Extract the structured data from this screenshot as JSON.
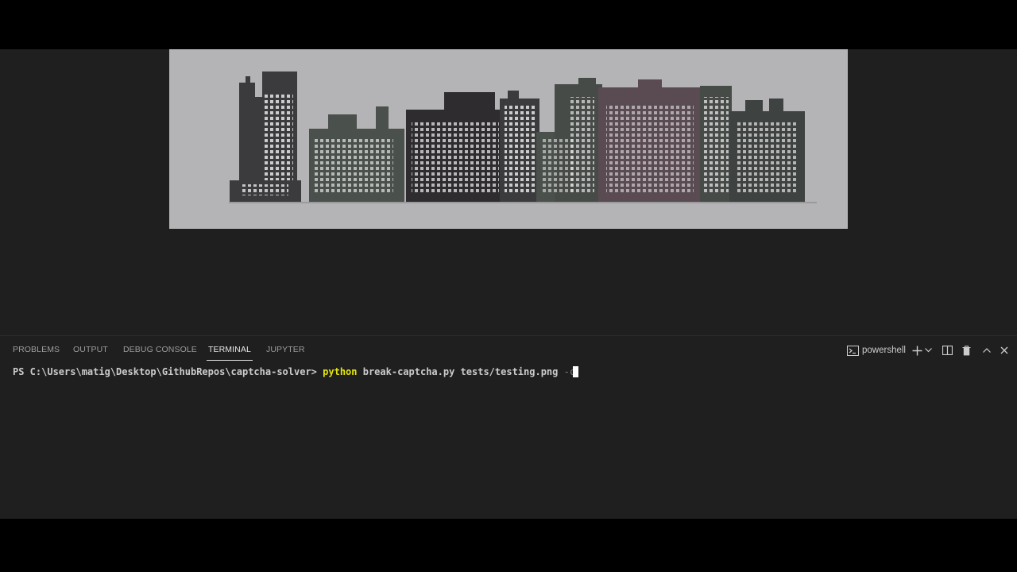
{
  "panel": {
    "tabs": [
      {
        "label": "PROBLEMS"
      },
      {
        "label": "OUTPUT"
      },
      {
        "label": "DEBUG CONSOLE"
      },
      {
        "label": "TERMINAL"
      },
      {
        "label": "JUPYTER"
      }
    ],
    "active_tab": "TERMINAL",
    "shell_name": "powershell",
    "icons": [
      "terminal-icon",
      "plus-icon",
      "chevron-down-icon",
      "split-icon",
      "trash-icon",
      "chevron-up-icon",
      "close-icon"
    ]
  },
  "terminal": {
    "prompt": "PS C:\\Users\\matig\\Desktop\\GithubRepos\\captcha-solver> ",
    "command": "python",
    "args": " break-captcha.py tests/testing.png ",
    "option": "-c"
  },
  "preview": {
    "description_icon": "captcha-image"
  },
  "colors": {
    "background": "#1f1f1f",
    "image_bg": "#b4b3b6",
    "command": "#e5e510",
    "active_tab": "#e7e7e7"
  }
}
